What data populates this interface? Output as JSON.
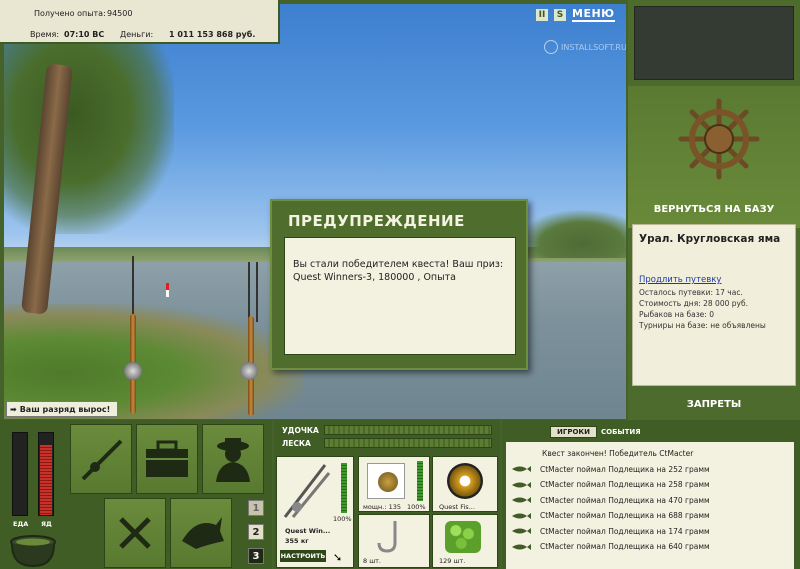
{
  "status": {
    "exp_label": "Получено опыта:",
    "exp_value": "94500",
    "time_label": "Время:",
    "time_value": "07:10 ВС",
    "money_label": "Деньги:",
    "money_value": "1 011 153 868 руб."
  },
  "top_icons": {
    "pause": "II",
    "sound": "S",
    "menu": "МЕНЮ"
  },
  "watermark": "INSTALLSOFT.RU",
  "right_panel": {
    "return_label": "ВЕРНУТЬСЯ НА БАЗУ",
    "location_title": "Урал. Кругловская яма",
    "extend_link": "Продлить путевку",
    "info_lines": [
      "Осталось путевки: 17 час.",
      "Стоимость дня: 28 000 руб.",
      "Рыбаков на базе: 0",
      "Турниры на базе: не объявлены"
    ],
    "bans_label": "ЗАПРЕТЫ"
  },
  "dialog": {
    "title": "ПРЕДУПРЕЖДЕНИЕ",
    "message": "Вы стали победителем квеста! Ваш приз: Quest Winners-3, 180000 , Опыта"
  },
  "toast": "Ваш разряд вырос!",
  "needs": {
    "food_label": "ЕДА",
    "poison_label": "ЯД",
    "food_level": 0.0,
    "poison_level": 0.85
  },
  "page_buttons": [
    "1",
    "2",
    "3"
  ],
  "gear": {
    "rod_label": "УДОЧКА",
    "line_label": "ЛЕСКА",
    "rod_name": "Quest Win...",
    "rod_weight": "355 кг",
    "rod_percent": "100%",
    "reel_label": "мощн.: 135",
    "reel_percent": "100%",
    "line_name": "Quest Fis...",
    "hook_count": "8 шт.",
    "bait_count": "129 шт.",
    "setup_label": "НАСТРОИТЬ"
  },
  "chat": {
    "tab_players": "ИГРОКИ",
    "tab_events": "СОБЫТИЯ",
    "header_line": "Квест закончен! Победитель CtMacter",
    "lines": [
      "CtMacter поймал Подлещика на 252 грамм",
      "CtMacter поймал Подлещика на 258 грамм",
      "CtMacter поймал Подлещика на 470 грамм",
      "CtMacter поймал Подлещика на 688 грамм",
      "CtMacter поймал Подлещика на 174 грамм",
      "CtMacter поймал Подлещика на 640 грамм"
    ]
  },
  "colors": {
    "panel_green": "#4d6b2c",
    "cream": "#f3f1e0",
    "accent_red": "#c8322a"
  }
}
